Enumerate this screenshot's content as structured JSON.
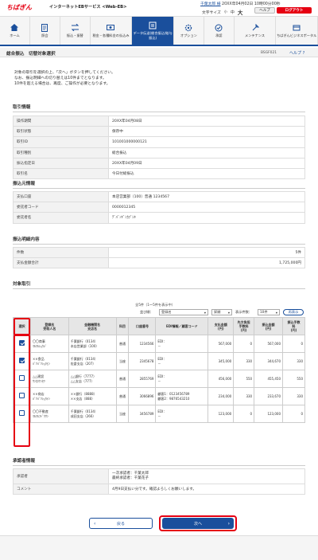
{
  "header": {
    "logo": "ちばぎん",
    "service": "インターネットEBサービス <Web-EB>",
    "user_name": "千葉太郎 様",
    "login_time": "20XX年04月02日 10時00分00秒",
    "font_size_label": "文字サイズ",
    "font_small": "小",
    "font_medium": "中",
    "font_large": "大",
    "help": "ヘルプ",
    "logout": "ログアウト"
  },
  "nav": [
    {
      "label": "ホーム",
      "icon": "home-icon"
    },
    {
      "label": "照会",
      "icon": "document-icon"
    },
    {
      "label": "振込・振替",
      "icon": "transfer-icon"
    },
    {
      "label": "税金・各種料金の払込み",
      "icon": "tax-icon"
    },
    {
      "label": "データ伝送(総合振込/給与振込)",
      "icon": "data-icon"
    },
    {
      "label": "オプション",
      "icon": "gear-icon"
    },
    {
      "label": "承認",
      "icon": "approve-icon"
    },
    {
      "label": "メンテナンス",
      "icon": "tools-icon"
    },
    {
      "label": "ちばぎんビジネスポータル",
      "icon": "portal-icon"
    }
  ],
  "page": {
    "breadcrumb": "総合振込　切替対象選択",
    "screen_id": "BSGF021",
    "help_link": "ヘルプ ?",
    "intro_lines": [
      "対象の取引を選択の上、「次へ」ボタンを押してください。",
      "なお、振込明細への切り替えは10件までとなります。",
      "10件を超える場合は、再度、ご操作が必要となります。"
    ]
  },
  "sections": {
    "transaction_info": "取引情報",
    "source_info": "振込元情報",
    "detail_info": "振込明細内容",
    "target": "対象取引",
    "approver": "承認者情報"
  },
  "transaction_info": [
    {
      "label": "操作期間",
      "value": "20XX年04月08日"
    },
    {
      "label": "取引状態",
      "value": "保存中"
    },
    {
      "label": "取引ID",
      "value": "101001000000121"
    },
    {
      "label": "取引種別",
      "value": "総合振込"
    },
    {
      "label": "振込指定日",
      "value": "20XX年04月09日"
    },
    {
      "label": "取引名",
      "value": "今日付総振込"
    }
  ],
  "source_info": [
    {
      "label": "支払口座",
      "value": "本店営業部（100）普通 1234567"
    },
    {
      "label": "委託者コード",
      "value": "0000012345"
    },
    {
      "label": "委託者名",
      "value": "ﾃﾞﾊﾞﾝｷﾞﾝｶﾌﾞｼｷ"
    }
  ],
  "detail_info": [
    {
      "label": "件数",
      "value": "5件"
    },
    {
      "label": "支払金額合計",
      "value": "1,725,000円"
    }
  ],
  "target": {
    "count_text": "全5件（1～5件を表示中）",
    "sort_label": "並び順：",
    "sort_value": "登録名",
    "order_value": "昇順",
    "per_page_label": "表示件数：",
    "per_page_value": "10件",
    "refresh_label": "再表示",
    "columns": [
      "選択",
      "登録名\n受取人名",
      "金融機関名\n支店名",
      "科目",
      "口座番号",
      "EDI情報／顧客コード",
      "支払金額\n(円)",
      "先方負担\n手数料\n(円)",
      "振込金額\n(円)",
      "振込手数\n料\n(円)"
    ],
    "rows": [
      {
        "checked": true,
        "name": "〇〇商事",
        "kana": "ﾏﾙﾏﾙｼｮｳｼﾞ",
        "bank": "千葉銀行（0134）",
        "branch": "本店営業部（100）",
        "type": "普通",
        "account": "1234566",
        "edi": "EDI：\n－",
        "amount": "567,000",
        "fee": "0",
        "transfer": "567,000",
        "tfee": "0"
      },
      {
        "checked": true,
        "name": "××食品",
        "kana": "ﾊﾞﾂﾊﾞﾂｼｮｸﾋﾝ",
        "bank": "千葉銀行（0134）",
        "branch": "佐倉支店（207）",
        "type": "当座",
        "account": "2345678",
        "edi": "EDI：\n－",
        "amount": "345,000",
        "fee": "330",
        "transfer": "344,670",
        "tfee": "330"
      },
      {
        "checked": false,
        "name": "△△建設",
        "kana": "ｻﾝｶｸｹﾝｾﾂ",
        "bank": "△△銀行（7777）",
        "branch": "△△支店（777）",
        "type": "普通",
        "account": "2855769",
        "edi": "EDI：\n－",
        "amount": "456,000",
        "fee": "550",
        "transfer": "455,450",
        "tfee": "550"
      },
      {
        "checked": false,
        "name": "××商店",
        "kana": "ﾊﾞﾂﾊﾞﾂｼｮｳﾃﾝ",
        "bank": "××銀行（8888）",
        "branch": "××支店（888）",
        "type": "普通",
        "account": "3066896",
        "edi": "顧客1：0123456789\n顧客2：9876543210",
        "amount": "234,000",
        "fee": "330",
        "transfer": "233,670",
        "tfee": "330"
      },
      {
        "checked": false,
        "name": "〇〇不動産",
        "kana": "ﾏﾙﾏﾙﾌﾄﾞｳｻﾝ",
        "bank": "千葉銀行（0134）",
        "branch": "成田支店（266）",
        "type": "当座",
        "account": "3456789",
        "edi": "EDI：\n－",
        "amount": "123,000",
        "fee": "0",
        "transfer": "123,000",
        "tfee": "0"
      }
    ]
  },
  "approver_info": [
    {
      "label": "承認者",
      "value": "一次承認者：千葉太郎\n最終承認者：千葉花子"
    },
    {
      "label": "コメント",
      "value": "4月9日支払い分です。確認よろしくお願いします。"
    }
  ],
  "buttons": {
    "back": "戻る",
    "next": "次へ"
  },
  "colors": {
    "brand_red": "#e60012",
    "primary_blue": "#1a4f9c"
  }
}
